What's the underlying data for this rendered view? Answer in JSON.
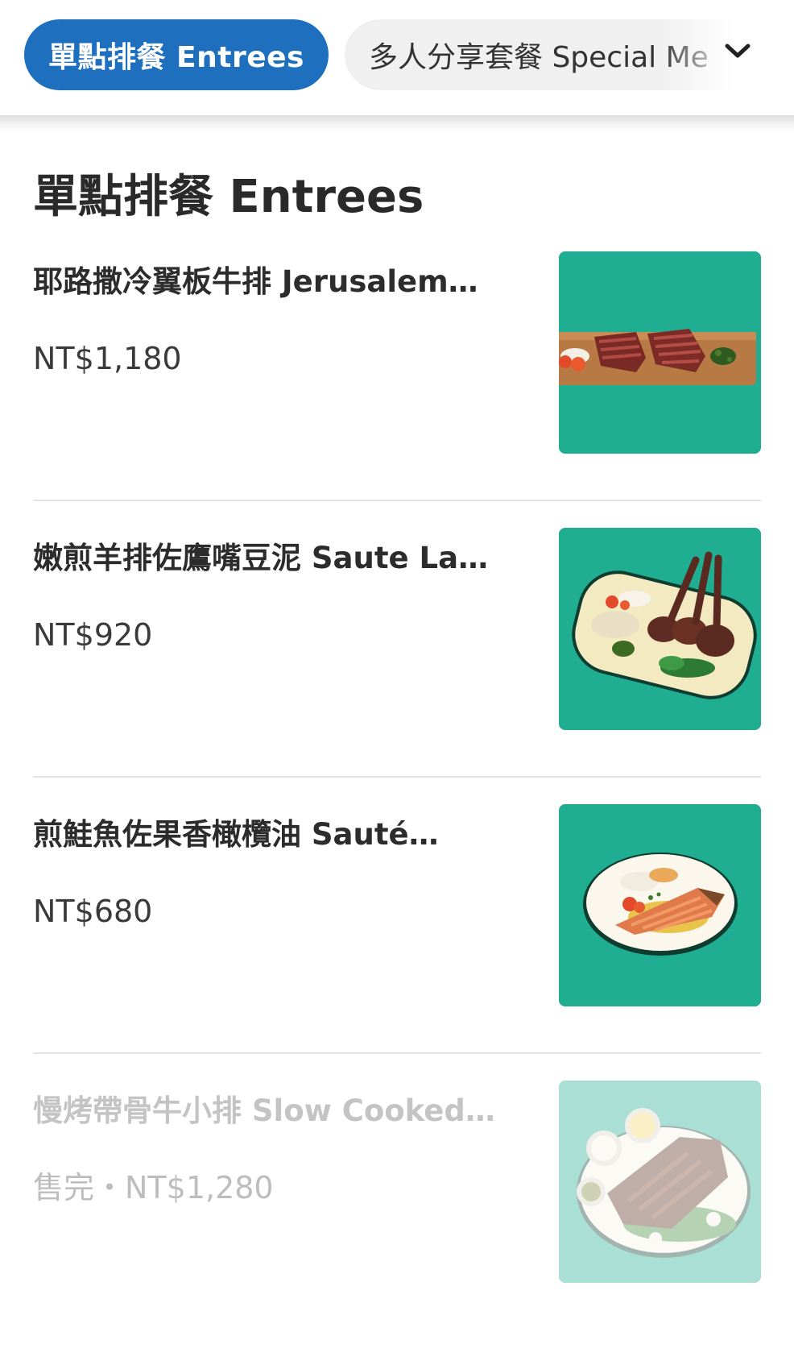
{
  "tabs": {
    "active_label": "單點排餐 Entrees",
    "other_label": "多人分享套餐 Special Me"
  },
  "section": {
    "title": "單點排餐 Entrees"
  },
  "items": [
    {
      "name": "耶路撒冷翼板牛排 Jerusalem…",
      "price": "NT$1,180",
      "image": "flat-iron-steak-photo",
      "sold_out": false
    },
    {
      "name": "嫩煎羊排佐鷹嘴豆泥 Saute La…",
      "price": "NT$920",
      "image": "lamb-chops-photo",
      "sold_out": false
    },
    {
      "name": "煎鮭魚佐果香橄欖油 Sauté…",
      "price": "NT$680",
      "image": "salmon-plate-photo",
      "sold_out": false
    },
    {
      "name": "慢烤帶骨牛小排 Slow Cooked…",
      "price": "售完・NT$1,280",
      "image": "short-rib-photo",
      "sold_out": true
    }
  ],
  "colors": {
    "active_tab": "#1f6fbf",
    "photo_background": "#1fae91",
    "sold_out_text": "#c4c4c4"
  },
  "icons": {
    "dropdown": "chevron-down-icon"
  }
}
